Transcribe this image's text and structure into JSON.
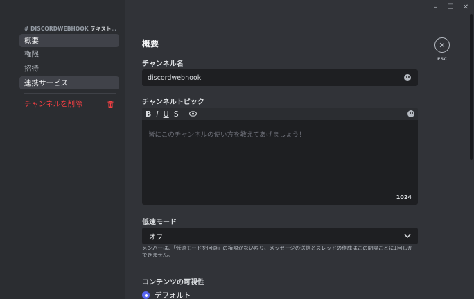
{
  "sidebar": {
    "header_prefix": "#",
    "header_name": "DISCORDWEBHOOK",
    "header_suffix": "テキストチャ…",
    "items": [
      {
        "label": "概要"
      },
      {
        "label": "権限"
      },
      {
        "label": "招待"
      },
      {
        "label": "連携サービス"
      }
    ],
    "delete_label": "チャンネルを削除"
  },
  "main": {
    "title": "概要",
    "channel_name_label": "チャンネル名",
    "channel_name_value": "discordwebhook",
    "topic_label": "チャンネルトピック",
    "toolbar": [
      "B",
      "I",
      "U",
      "S"
    ],
    "topic_placeholder": "皆にこのチャンネルの使い方を教えてあげましょう！",
    "topic_counter": "1024",
    "slowmode_label": "低速モード",
    "slowmode_value": "オフ",
    "slowmode_help": "メンバーは、「低速モードを回避」の権限がない限り、メッセージの送信とスレッドの作成はこの間隔ごとに1回しかできません。",
    "visibility_label": "コンテンツの可視性",
    "visibility_option": "デフォルト",
    "esc_label": "ESC"
  },
  "window": {
    "minimize": "–",
    "maximize": "☐",
    "close": "✕"
  },
  "colors": {
    "accent": "#5865f2",
    "danger": "#f23f43"
  }
}
